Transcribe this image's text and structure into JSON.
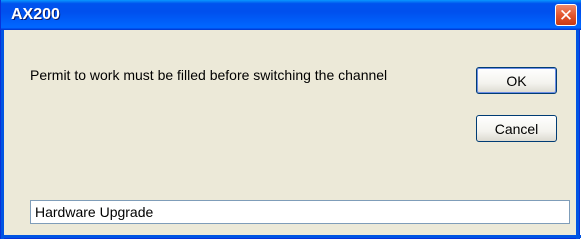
{
  "window": {
    "title": "AX200",
    "close_glyph": "✕"
  },
  "dialog": {
    "message": "Permit to work must be filled before switching the channel",
    "ok_label": "OK",
    "cancel_label": "Cancel",
    "input_value": "Hardware Upgrade"
  },
  "colors": {
    "titlebar": "#0054e3",
    "dialog_background": "#ece9d8",
    "close_button": "#e2532a"
  },
  "icons": {
    "close": "close-icon"
  }
}
